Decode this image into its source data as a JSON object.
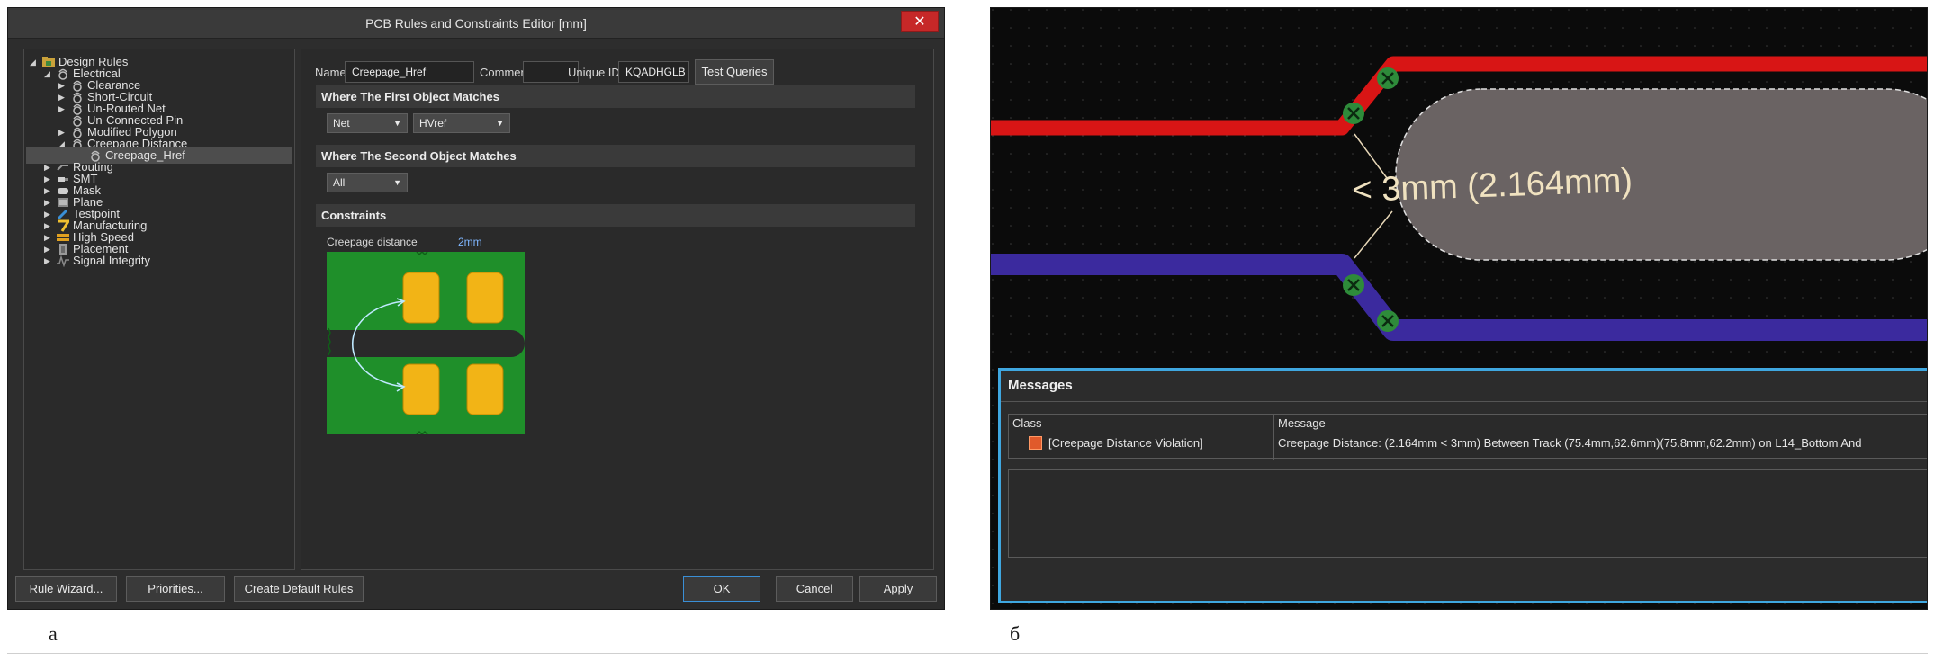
{
  "dialog": {
    "title": "PCB Rules and Constraints Editor [mm]",
    "close_glyph": "✕"
  },
  "tree": [
    {
      "label": "Design Rules",
      "icon": "folder-rules-icon"
    },
    {
      "label": "Electrical",
      "icon": "rule-icon"
    },
    {
      "label": "Clearance",
      "icon": "rule-icon"
    },
    {
      "label": "Short-Circuit",
      "icon": "rule-icon"
    },
    {
      "label": "Un-Routed Net",
      "icon": "rule-icon"
    },
    {
      "label": "Un-Connected Pin",
      "icon": "rule-icon"
    },
    {
      "label": "Modified Polygon",
      "icon": "rule-icon"
    },
    {
      "label": "Creepage Distance",
      "icon": "rule-icon"
    },
    {
      "label": "Creepage_Href",
      "icon": "rule-icon",
      "selected": true
    },
    {
      "label": "Routing",
      "icon": "routing-icon"
    },
    {
      "label": "SMT",
      "icon": "smt-icon"
    },
    {
      "label": "Mask",
      "icon": "mask-icon"
    },
    {
      "label": "Plane",
      "icon": "plane-icon"
    },
    {
      "label": "Testpoint",
      "icon": "testpoint-icon"
    },
    {
      "label": "Manufacturing",
      "icon": "manufacturing-icon"
    },
    {
      "label": "High Speed",
      "icon": "high-speed-icon"
    },
    {
      "label": "Placement",
      "icon": "placement-icon"
    },
    {
      "label": "Signal Integrity",
      "icon": "signal-integrity-icon"
    }
  ],
  "rule": {
    "name_label": "Name",
    "name_value": "Creepage_Href",
    "comment_label": "Comment",
    "comment_value": "",
    "uid_label": "Unique ID",
    "uid_value": "KQADHGLB",
    "test_queries": "Test Queries"
  },
  "first_match": {
    "header": "Where The First Object Matches",
    "type": "Net",
    "value": "HVref"
  },
  "second_match": {
    "header": "Where The Second Object Matches",
    "type": "All"
  },
  "constraints": {
    "header": "Constraints",
    "label": "Creepage distance",
    "value": "2mm"
  },
  "buttons": {
    "rule_wizard": "Rule Wizard...",
    "priorities": "Priorities...",
    "create_default": "Create Default Rules",
    "ok": "OK",
    "cancel": "Cancel",
    "apply": "Apply"
  },
  "pcb": {
    "measure_label": "< 3mm (2.164mm)",
    "colors": {
      "red_track": "#d81515",
      "blue_track": "#3b2a9e",
      "pad": "#6a6363",
      "via": "#2e8b3a"
    }
  },
  "messages": {
    "title": "Messages",
    "col_class": "Class",
    "col_message": "Message",
    "row_class": "[Creepage Distance Violation]",
    "row_message": "Creepage Distance: (2.164mm < 3mm) Between Track (75.4mm,62.6mm)(75.8mm,62.2mm) on L14_Bottom And"
  },
  "captions": {
    "a": "а",
    "b": "б"
  }
}
